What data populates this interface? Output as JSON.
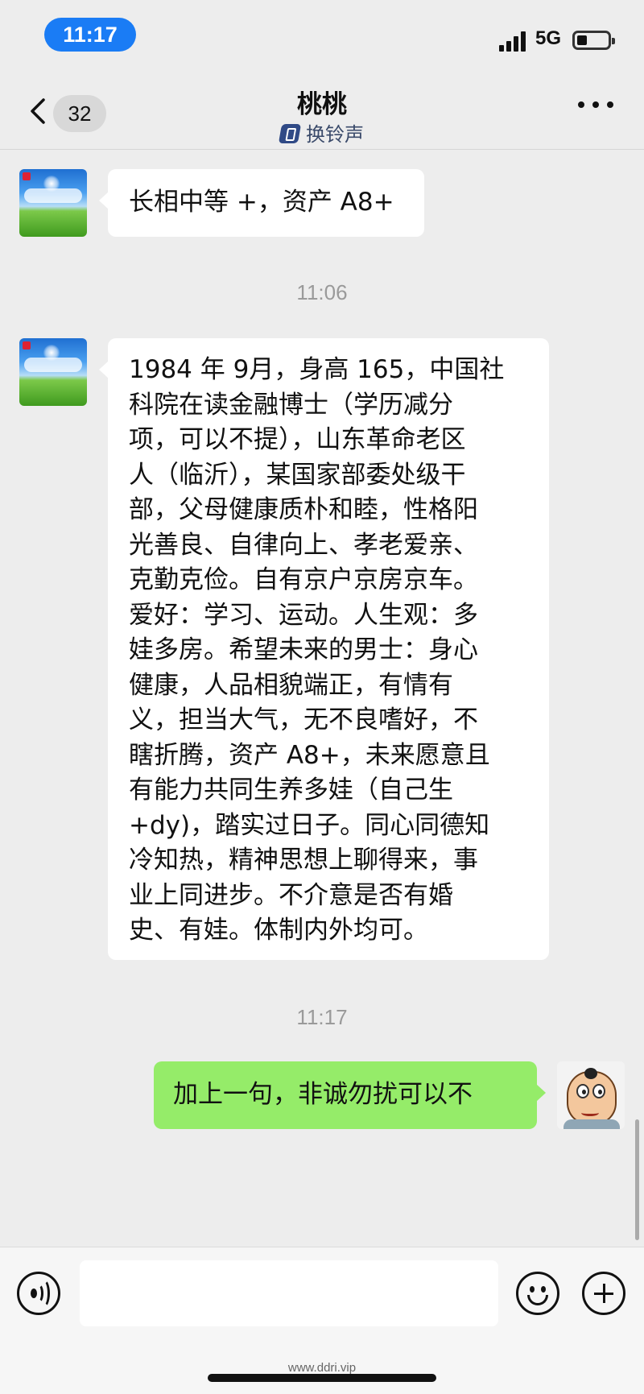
{
  "status_bar": {
    "time": "11:17",
    "network": "5G"
  },
  "header": {
    "unread_count": "32",
    "title": "桃桃",
    "subtitle": "换铃声"
  },
  "messages": [
    {
      "side": "left",
      "lines": [
        "长相中等 +，资产 A8+"
      ]
    },
    {
      "timestamp": "11:06"
    },
    {
      "side": "left",
      "lines": [
        "1984 年 9月，身高 165，中国社",
        "科院在读金融博士（学历减分",
        "项，可以不提），山东革命老区",
        "人（临沂），某国家部委处级干",
        "部，父母健康质朴和睦，性格阳",
        "光善良、自律向上、孝老爱亲、",
        "克勤克俭。自有京户京房京车。",
        "爱好：学习、运动。人生观：多",
        "娃多房。希望未来的男士：身心",
        "健康，人品相貌端正，有情有",
        "义，担当大气，无不良嗜好，不",
        "瞎折腾，资产 A8+，未来愿意且",
        "有能力共同生养多娃（自己生",
        "+dy)，踏实过日子。同心同德知",
        "冷知热，精神思想上聊得来，事",
        "业上同进步。不介意是否有婚",
        "史、有娃。体制内外均可。"
      ]
    },
    {
      "timestamp": "11:17"
    },
    {
      "side": "right",
      "lines": [
        "加上一句，非诚勿扰可以不"
      ]
    }
  ],
  "input": {
    "value": ""
  },
  "watermark": "www.ddri.vip",
  "colors": {
    "time_pill": "#1a7cf5",
    "my_bubble": "#95ec69",
    "their_bubble": "#ffffff",
    "background": "#ededed"
  },
  "icons": [
    "back-icon",
    "more-icon",
    "ring-icon",
    "voice-icon",
    "emoji-icon",
    "plus-icon"
  ]
}
